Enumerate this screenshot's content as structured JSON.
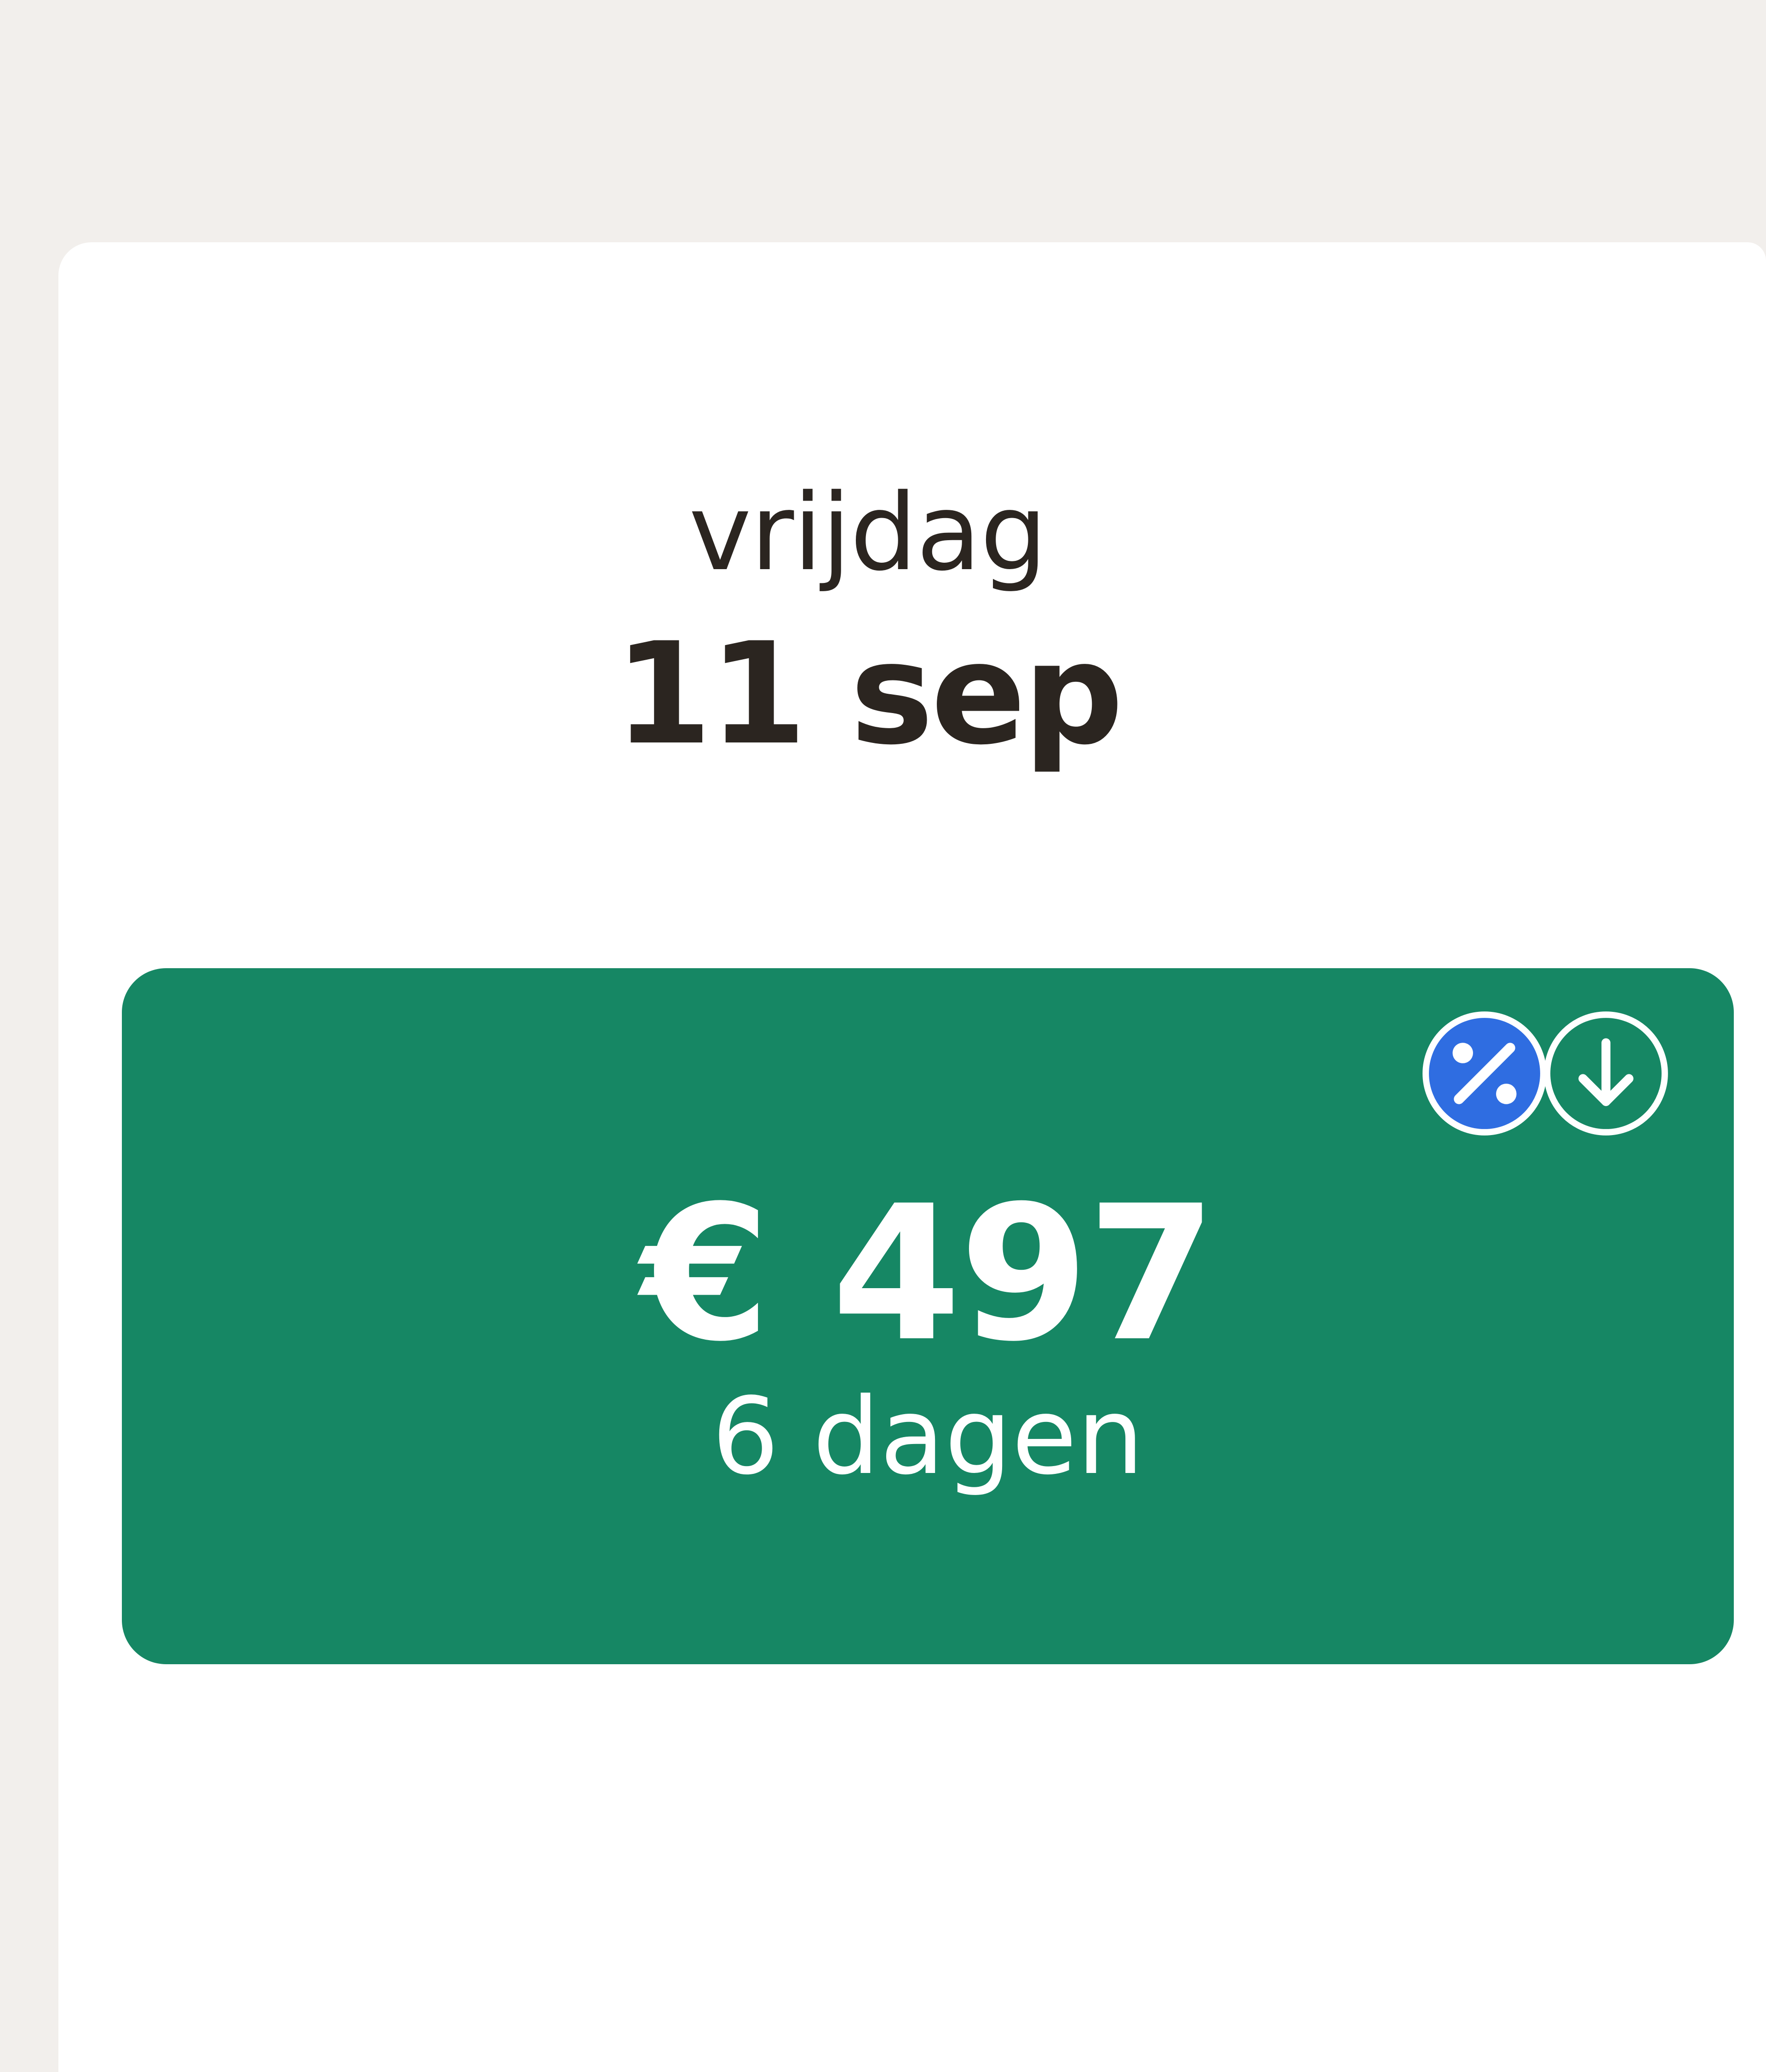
{
  "day": {
    "weekday": "vrijdag",
    "date": "11 sep"
  },
  "offer": {
    "price": "€ 497",
    "duration": "6 dagen",
    "badges": [
      "discount-percent-icon",
      "price-down-arrow-icon"
    ]
  },
  "colors": {
    "background": "#f2efec",
    "card": "#ffffff",
    "text": "#2b2520",
    "tile": "#168764",
    "discount_badge": "#2f6de1"
  }
}
